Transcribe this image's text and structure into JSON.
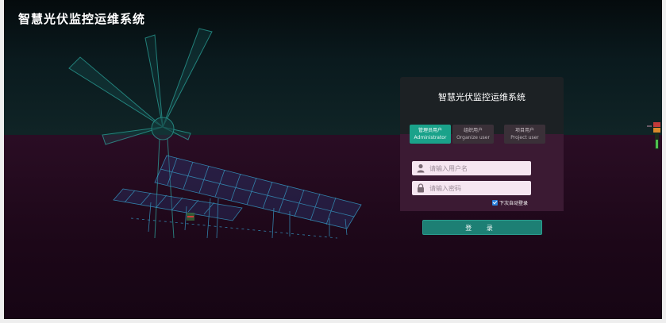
{
  "app": {
    "title": "智慧光伏监控运维系统"
  },
  "login": {
    "title": "智慧光伏监控运维系统",
    "tabs": [
      {
        "label": "管理员用户",
        "sub": "Administrator",
        "active": true
      },
      {
        "label": "组织用户",
        "sub": "Organize user",
        "active": false
      },
      {
        "label": "项目用户",
        "sub": "Project user",
        "active": false
      }
    ],
    "username": {
      "placeholder": "请输入用户名",
      "value": ""
    },
    "password": {
      "placeholder": "请输入密码",
      "value": ""
    },
    "remember": {
      "label": "下次自动登录",
      "checked": true
    },
    "submit_label": "登 录"
  },
  "colors": {
    "accent": "#1aa28a",
    "button": "#1d7f74",
    "panel_dark": "#1c2124",
    "panel_body": "#3b1a33"
  },
  "icons": [
    "user-icon",
    "lock-icon",
    "checkbox-icon"
  ]
}
